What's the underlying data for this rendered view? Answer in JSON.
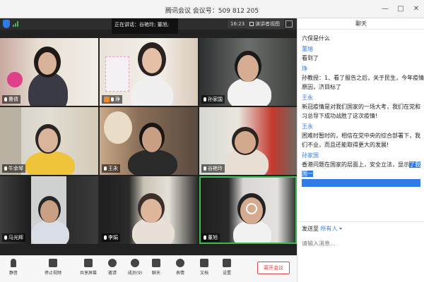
{
  "window": {
    "title": "腾讯会议 会议号：509 812 205",
    "controls": {
      "minimize": "—",
      "maximize": "□",
      "close": "✕"
    }
  },
  "video_header": {
    "speaking": "正在讲话：谷艳玲; 董旭;",
    "clock": "16:23",
    "speaker_view": "演讲者视图",
    "security_icon": "shield-icon",
    "signal_icon": "signal-bars-icon"
  },
  "participants": [
    {
      "name": "曹倩"
    },
    {
      "name": "琤"
    },
    {
      "name": "孙家国"
    },
    {
      "name": "牛余琴"
    },
    {
      "name": "王永"
    },
    {
      "name": "谷艳玲"
    },
    {
      "name": "马光辉"
    },
    {
      "name": "李娟"
    },
    {
      "name": "董旭"
    }
  ],
  "toolbar": {
    "items": [
      {
        "label": "静音",
        "icon": "microphone-icon"
      },
      {
        "label": "停止视频",
        "icon": "camera-icon"
      },
      {
        "label": "共享屏幕",
        "icon": "share-screen-icon"
      },
      {
        "label": "邀请",
        "icon": "invite-icon"
      },
      {
        "label": "成员(9)",
        "icon": "members-icon"
      },
      {
        "label": "聊天",
        "icon": "chat-icon"
      },
      {
        "label": "表情",
        "icon": "emoji-icon"
      },
      {
        "label": "文档",
        "icon": "document-icon"
      },
      {
        "label": "设置",
        "icon": "settings-icon"
      }
    ],
    "leave_label": "离开会议"
  },
  "chat": {
    "title": "聊天",
    "messages": [
      {
        "sender": "",
        "text": "六保是什么"
      },
      {
        "sender": "董旭",
        "text": "看到了"
      },
      {
        "sender": "琤",
        "text": "孙教授：1、看了报告之后，关于民生，今年疫情原因，济目标了"
      },
      {
        "sender": "王永",
        "text": "新冠疫情是对我们国家的一场大考，我们在党和习总导下成功战胜了这次疫情!"
      },
      {
        "sender": "王永",
        "text": "困难时暂时的，相信在党中央的综合部署下，我们不业，而且还能取得更大的发展!"
      },
      {
        "sender": "孙家国",
        "text_before": "香港问题在国家的层面上，安全立法，显示",
        "text_selected": "了我国一"
      }
    ],
    "send_to_label": "发送至",
    "send_to_target": "所有人",
    "input_placeholder": "请输入消息..."
  }
}
